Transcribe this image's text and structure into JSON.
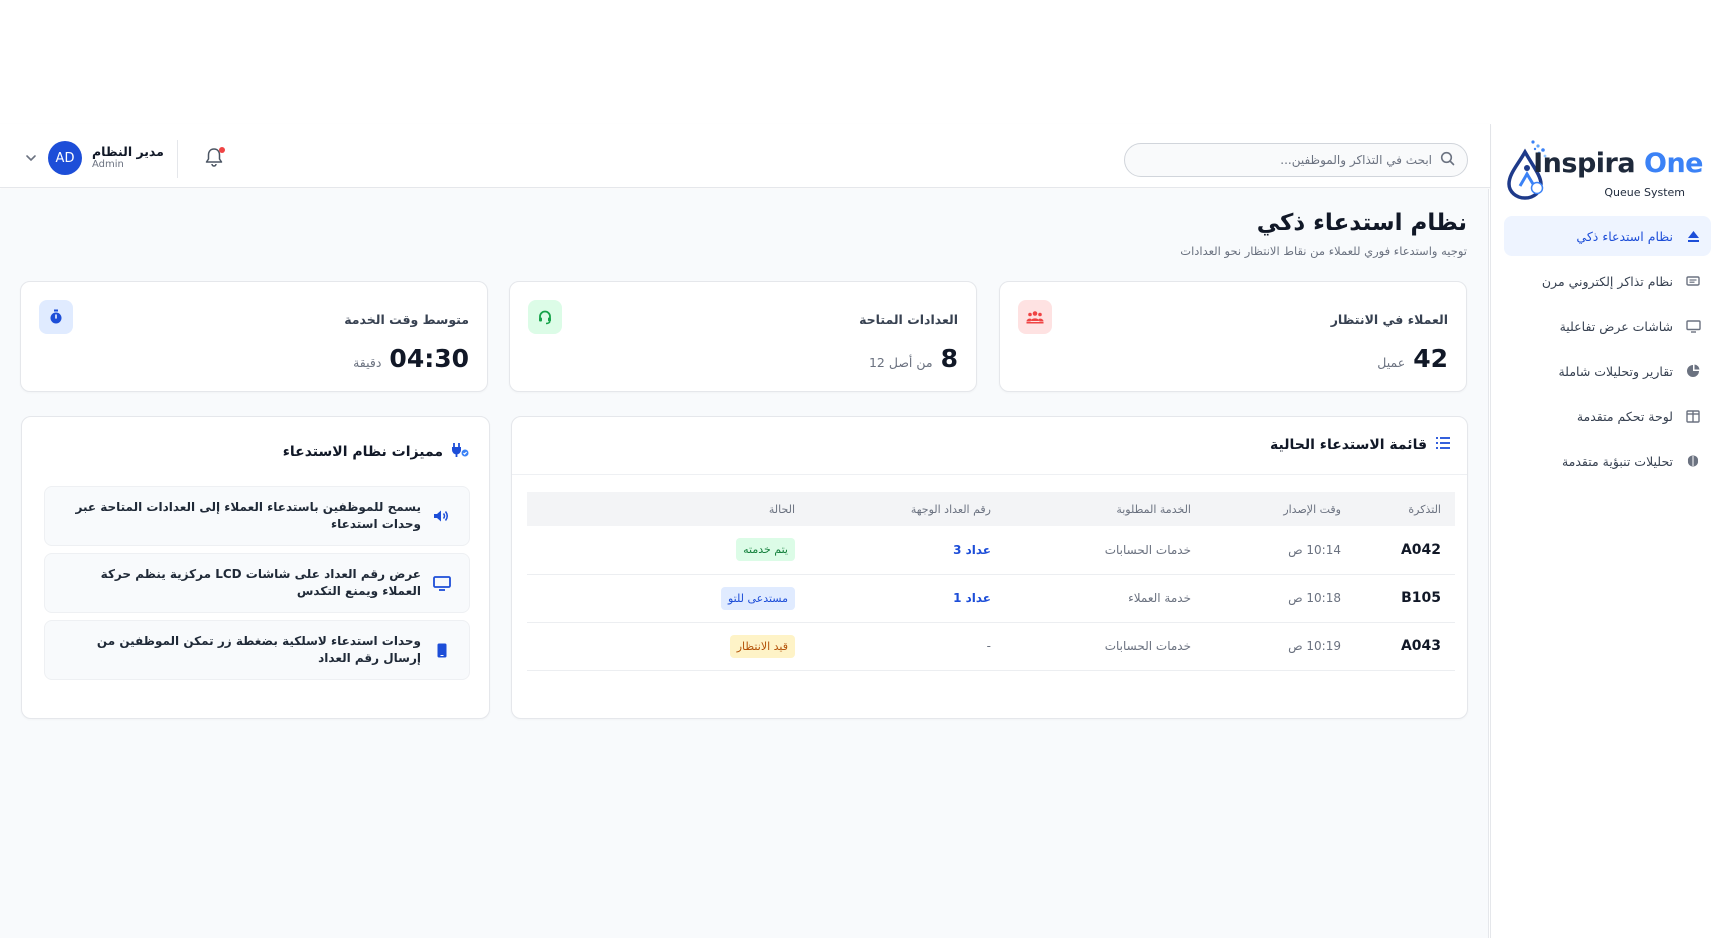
{
  "brand": {
    "name_main": "Inspira",
    "name_accent": " One",
    "subtitle": "Queue System"
  },
  "sidebar": {
    "items": [
      {
        "label": "نظام استدعاء ذكي",
        "icon": "eject-icon",
        "active": true
      },
      {
        "label": "نظام تذاكر إلكتروني مرن",
        "icon": "ticket-icon",
        "active": false
      },
      {
        "label": "شاشات عرض تفاعلية",
        "icon": "monitor-icon",
        "active": false
      },
      {
        "label": "تقارير وتحليلات شاملة",
        "icon": "pie-chart-icon",
        "active": false
      },
      {
        "label": "لوحة تحكم متقدمة",
        "icon": "columns-icon",
        "active": false
      },
      {
        "label": "تحليلات تنبؤية متقدمة",
        "icon": "brain-icon",
        "active": false
      }
    ]
  },
  "header": {
    "search_placeholder": "ابحث في التذاكر والموظفين...",
    "user": {
      "name": "مدير النظام",
      "role": "Admin",
      "initials": "AD"
    }
  },
  "page": {
    "title": "نظام استدعاء ذكي",
    "subtitle": "توجيه واستدعاء فوري للعملاء من نقاط الانتظار نحو العدادات"
  },
  "stats": [
    {
      "label": "العملاء في الانتظار",
      "value": "42",
      "unit": "عميل",
      "icon": "users-icon",
      "color": "#ef4444",
      "bg": "#fee2e2"
    },
    {
      "label": "العدادات المتاحة",
      "value": "8",
      "unit": "من أصل 12",
      "icon": "headset-icon",
      "color": "#16a34a",
      "bg": "#dcfce7"
    },
    {
      "label": "متوسط وقت الخدمة",
      "value": "04:30",
      "unit": "دقيقة",
      "icon": "stopwatch-icon",
      "color": "#1d4ed8",
      "bg": "#e0ebff"
    }
  ],
  "queue": {
    "title": "قائمة الاستدعاء الحالية",
    "columns": [
      "التذكرة",
      "وقت الإصدار",
      "الخدمة المطلوبة",
      "رقم العداد الوجهة",
      "الحالة"
    ],
    "rows": [
      {
        "ticket": "A042",
        "time": "10:14 ص",
        "service": "خدمات الحسابات",
        "counter": "عداد 3",
        "status": "يتم خدمته",
        "status_type": "serving"
      },
      {
        "ticket": "B105",
        "time": "10:18 ص",
        "service": "خدمة العملاء",
        "counter": "عداد 1",
        "status": "مستدعى للتو",
        "status_type": "called"
      },
      {
        "ticket": "A043",
        "time": "10:19 ص",
        "service": "خدمات الحسابات",
        "counter": "-",
        "status": "قيد الانتظار",
        "status_type": "waiting"
      }
    ]
  },
  "features": {
    "title": "مميزات نظام الاستدعاء",
    "items": [
      {
        "text": "يسمح للموظفين باستدعاء العملاء إلى العدادات المتاحة عبر وحدات استدعاء",
        "icon": "speaker-icon"
      },
      {
        "text": "عرض رقم العداد على شاشات LCD مركزية ينظم حركة العملاء ويمنع التكدس",
        "icon": "monitor-icon"
      },
      {
        "text": "وحدات استدعاء لاسلكية بضغطة زر تمكن الموظفين من إرسال رقم العداد",
        "icon": "mobile-icon"
      }
    ]
  },
  "colors": {
    "primary": "#1d4ed8",
    "accent": "#3b82f6",
    "background": "#f8fafc"
  }
}
